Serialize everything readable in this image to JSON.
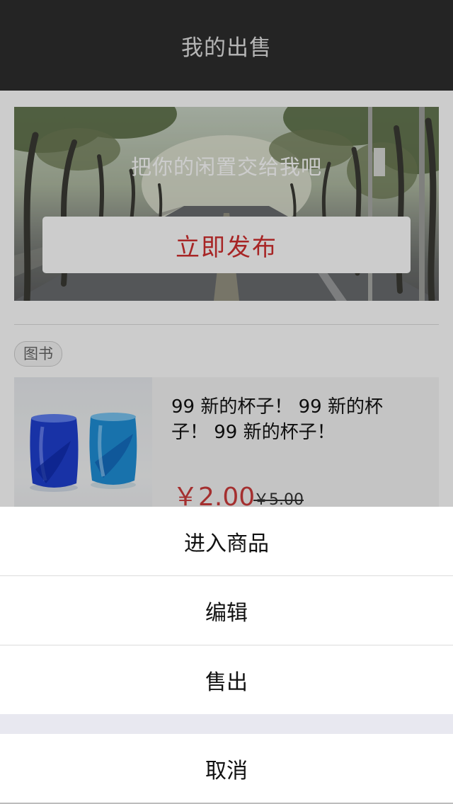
{
  "header": {
    "title": "我的出售"
  },
  "banner": {
    "slogan": "把你的闲置交给我吧",
    "publish_label": "立即发布"
  },
  "category": {
    "label": "图书"
  },
  "product": {
    "title": "99 新的杯子！ 99 新的杯子！ 99 新的杯子！",
    "price": "￥2.00",
    "original_price": "￥5.00",
    "image": "blue-glass-cups"
  },
  "action_sheet": {
    "items": [
      "进入商品",
      "编辑",
      "售出"
    ],
    "cancel_label": "取消"
  },
  "colors": {
    "header_bg": "#2d2d2d",
    "accent_red": "#d12f2f",
    "price_red": "#cd3b3b"
  }
}
